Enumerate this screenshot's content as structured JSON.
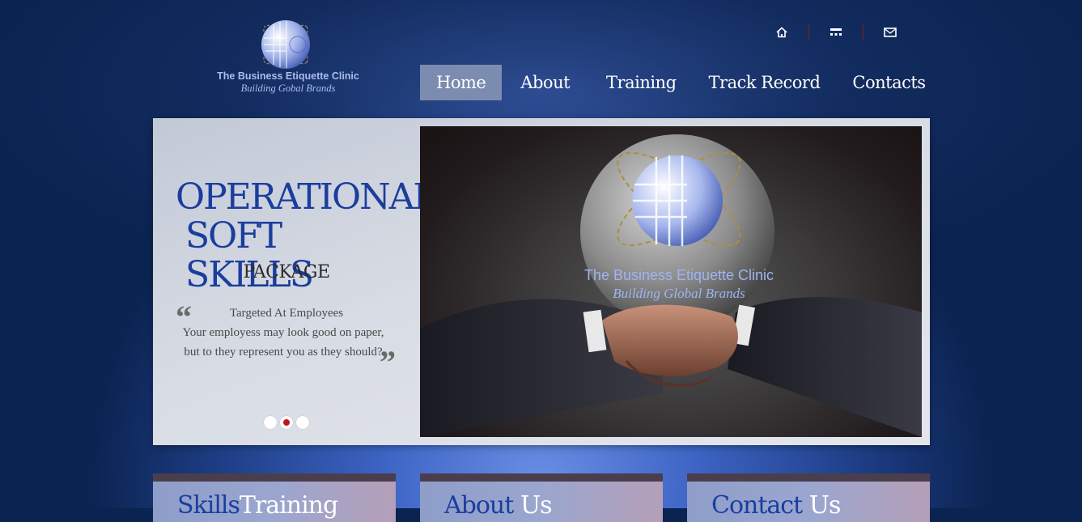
{
  "logo": {
    "title": "The Business Etiquette Clinic",
    "tagline": "Building Gobal Brands"
  },
  "top_icons": [
    "home-icon",
    "sitemap-icon",
    "mail-icon"
  ],
  "nav": {
    "items": [
      {
        "label": "Home",
        "active": true
      },
      {
        "label": "About",
        "active": false
      },
      {
        "label": "Training",
        "active": false
      },
      {
        "label": "Track Record",
        "active": false
      },
      {
        "label": "Contacts",
        "active": false
      }
    ]
  },
  "slide": {
    "heading_line1": "OPERATIONAL",
    "heading_line2": "SOFT SKILLS",
    "heading_line3": "PACKAGE",
    "quote_open": "“",
    "quote_close": "”",
    "quote_line1": "Targeted At Employees",
    "quote_line2": "Your employess may look good on paper,",
    "quote_line3": "but to they represent you as they should?",
    "image_title": "The Business Etiquette Clinic",
    "image_tagline": "Building Global Brands",
    "dots": 3,
    "active_dot": 2
  },
  "boxes": [
    {
      "title_a": "Skills",
      "title_b": "Training"
    },
    {
      "title_a": "About",
      "title_b": "Us"
    },
    {
      "title_a": "Contact",
      "title_b": "Us"
    }
  ],
  "colors": {
    "heading": "#1a3d9e",
    "nav_active_bg": "#7c8bb0",
    "active_dot": "#c0141b",
    "logo_text": "#a9bcee"
  }
}
